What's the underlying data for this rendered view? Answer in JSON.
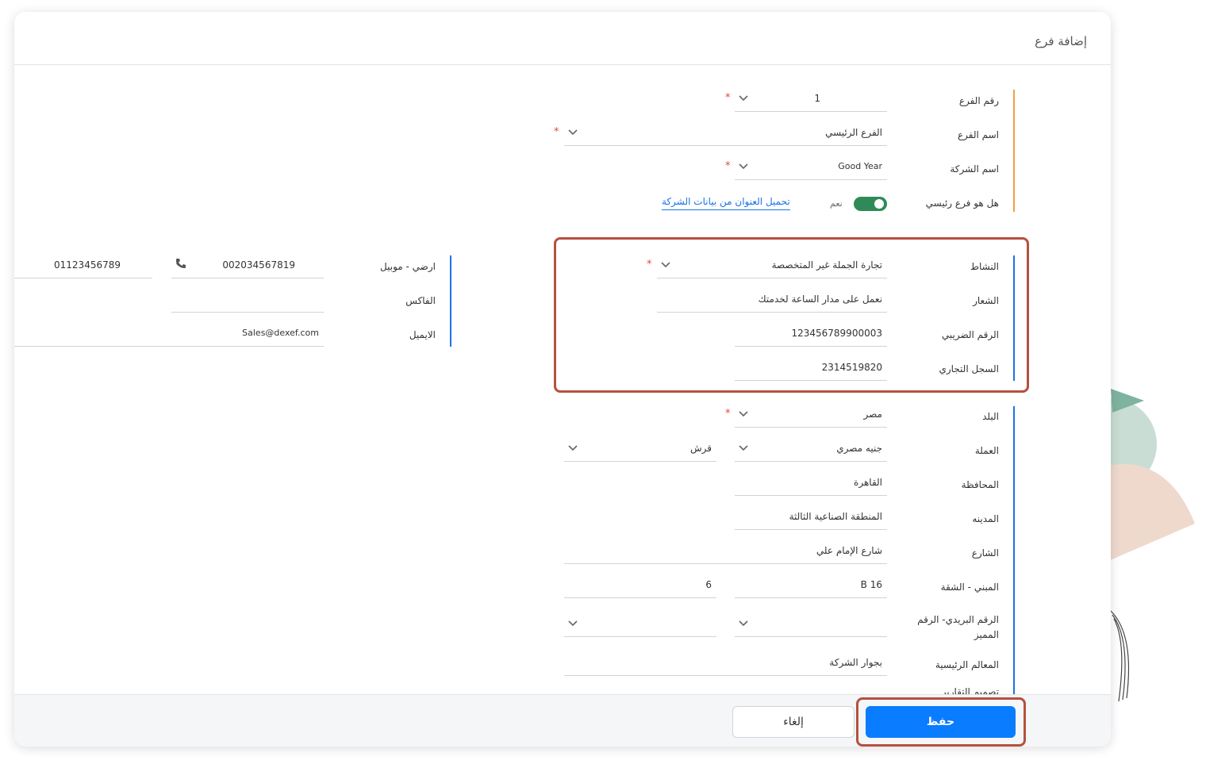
{
  "modal": {
    "title": "إضافة فرع"
  },
  "branch": {
    "number_label": "رقم الفرع",
    "number_value": "1",
    "name_label": "اسم الفرع",
    "name_value": "الفرع الرئيسي",
    "company_label": "اسم الشركة",
    "company_value": "Good Year",
    "is_main_label": "هل هو فرع رئيسي",
    "is_main_toggle_text": "نعم",
    "load_address_link": "تحميل العنوان من بيانات الشركة"
  },
  "business": {
    "activity_label": "النشاط",
    "activity_value": "تجارة الجملة غير المتخصصة",
    "slogan_label": "الشعار",
    "slogan_value": "نعمل على مدار الساعة لخدمتك",
    "tax_label": "الرقم الضريبي",
    "tax_value": "123456789900003",
    "register_label": "السجل التجاري",
    "register_value": "2314519820"
  },
  "address": {
    "country_label": "البلد",
    "country_value": "مصر",
    "currency_label": "العملة",
    "currency_value": "جنيه مصري",
    "subcurrency_value": "قرش",
    "governorate_label": "المحافظة",
    "governorate_value": "القاهرة",
    "city_label": "المدينه",
    "city_value": "المنطقة الصناعية الثالثة",
    "street_label": "الشارع",
    "street_value": "شارع الإمام علي",
    "building_label": "المبني - الشقة",
    "building_value": "B 16",
    "apartment_value": "6",
    "postal_label_line1": "الرقم البريدي- الرقم",
    "postal_label_line2": "المميز",
    "landmarks_label": "المعالم الرئيسية",
    "landmarks_value": "بجوار الشركة",
    "cut_label": "تصميم التقارير"
  },
  "contact": {
    "phone_label": "ارضي - موبيل",
    "landline_value": "002034567819",
    "mobile_value": "01123456789",
    "fax_label": "الفاكس",
    "email_label": "الايميل",
    "email_value": "Sales@dexef.com"
  },
  "footer": {
    "save_label": "حفظ",
    "cancel_label": "إلغاء"
  },
  "colors": {
    "accent_orange": "#f0a040",
    "accent_blue": "#1a73e8",
    "save_button": "#0a7cff",
    "toggle_on": "#2e8b57",
    "highlight_box": "#b5513f",
    "required": "#e04a3c"
  },
  "icons": [
    "chevron-down-icon",
    "phone-icon"
  ]
}
